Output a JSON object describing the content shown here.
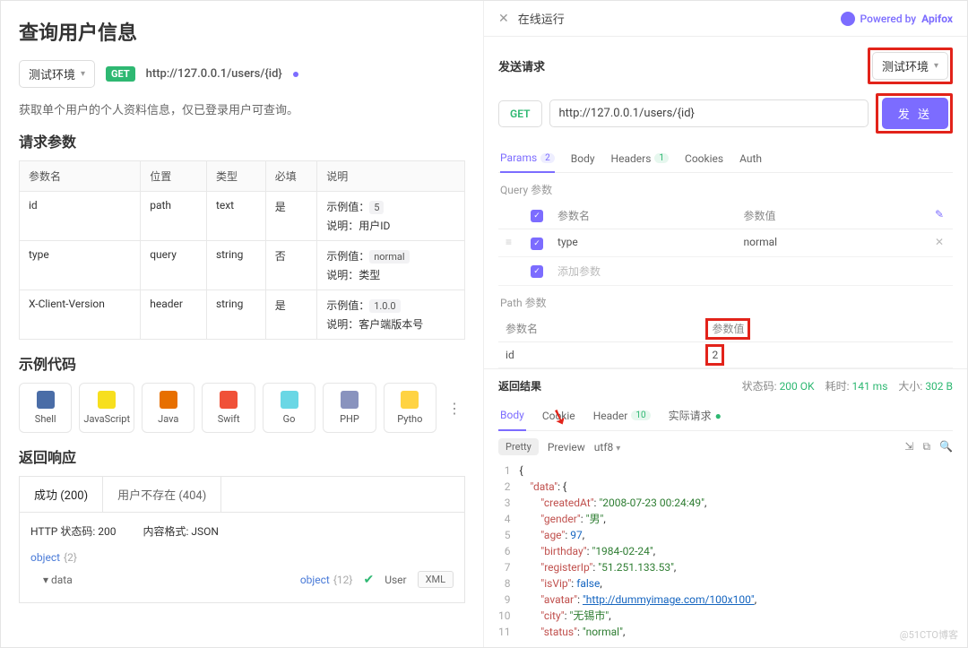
{
  "left": {
    "title": "查询用户信息",
    "env": "测试环境",
    "method": "GET",
    "url": "http://127.0.0.1/users/{id}",
    "desc": "获取单个用户的个人资料信息，仅已登录用户可查询。",
    "paramsHeading": "请求参数",
    "cols": {
      "name": "参数名",
      "pos": "位置",
      "type": "类型",
      "req": "必填",
      "desc": "说明"
    },
    "exLabel": "示例值：",
    "descLabel": "说明：",
    "params": [
      {
        "name": "id",
        "pos": "path",
        "type": "text",
        "req": "是",
        "ex": "5",
        "d": "用户ID"
      },
      {
        "name": "type",
        "pos": "query",
        "type": "string",
        "req": "否",
        "ex": "normal",
        "d": "类型"
      },
      {
        "name": "X-Client-Version",
        "pos": "header",
        "type": "string",
        "req": "是",
        "ex": "1.0.0",
        "d": "客户端版本号"
      }
    ],
    "sampleHeading": "示例代码",
    "langs": [
      "Shell",
      "JavaScript",
      "Java",
      "Swift",
      "Go",
      "PHP",
      "Pytho"
    ],
    "respHeading": "返回响应",
    "respTabs": [
      "成功 (200)",
      "用户不存在 (404)"
    ],
    "httpStatus": "HTTP 状态码: 200",
    "contentFmt": "内容格式: JSON",
    "objLabel": "object",
    "objCnt": "{2}",
    "dataLabel": "data",
    "dataType": "object",
    "dataCnt": "{12}",
    "userLabel": "User",
    "xml": "XML"
  },
  "right": {
    "runTitle": "在线运行",
    "powered": "Powered by",
    "brand": "Apifox",
    "sendTitle": "发送请求",
    "env": "测试环境",
    "method": "GET",
    "url": "http://127.0.0.1/users/{id}",
    "sendBtn": "发 送",
    "tabs": {
      "params": "Params",
      "paramsN": "2",
      "body": "Body",
      "headers": "Headers",
      "headersN": "1",
      "cookies": "Cookies",
      "auth": "Auth"
    },
    "queryLabel": "Query 参数",
    "pathLabel": "Path 参数",
    "cols": {
      "name": "参数名",
      "val": "参数值"
    },
    "query": [
      {
        "name": "type",
        "val": "normal"
      }
    ],
    "addParam": "添加参数",
    "path": [
      {
        "name": "id",
        "val": "2"
      }
    ],
    "resultTitle": "返回结果",
    "status": {
      "label": "状态码:",
      "val": "200 OK"
    },
    "time": {
      "label": "耗时:",
      "val": "141 ms"
    },
    "size": {
      "label": "大小:",
      "val": "302 B"
    },
    "resTabs": {
      "body": "Body",
      "cookie": "Cookie",
      "header": "Header",
      "headerN": "10",
      "actual": "实际请求"
    },
    "pretty": "Pretty",
    "preview": "Preview",
    "enc": "utf8",
    "json": {
      "createdAt": "2008-07-23 00:24:49",
      "gender": "男",
      "age": 97,
      "birthday": "1984-02-24",
      "registerIp": "51.251.133.53",
      "isVip": false,
      "avatar": "http://dummyimage.com/100x100",
      "city": "无锡市",
      "status": "normal"
    }
  },
  "watermark": "@51CTO博客"
}
